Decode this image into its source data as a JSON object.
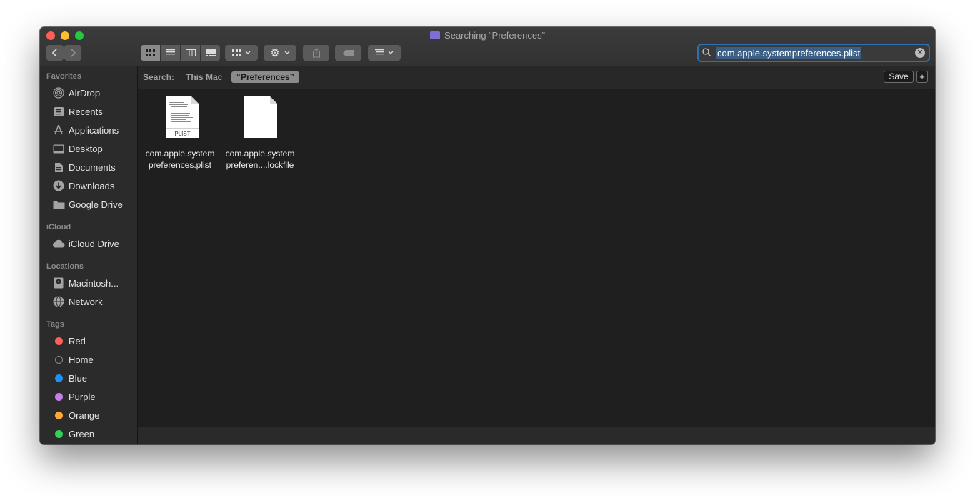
{
  "window": {
    "title": "Searching “Preferences”"
  },
  "search": {
    "query": "com.apple.systempreferences.plist"
  },
  "sidebar": {
    "favorites_header": "Favorites",
    "favorites": [
      {
        "label": "AirDrop"
      },
      {
        "label": "Recents"
      },
      {
        "label": "Applications"
      },
      {
        "label": "Desktop"
      },
      {
        "label": "Documents"
      },
      {
        "label": "Downloads"
      },
      {
        "label": "Google Drive"
      }
    ],
    "icloud_header": "iCloud",
    "icloud": [
      {
        "label": "iCloud Drive"
      }
    ],
    "locations_header": "Locations",
    "locations": [
      {
        "label": "Macintosh..."
      },
      {
        "label": "Network"
      }
    ],
    "tags_header": "Tags",
    "tags": [
      {
        "label": "Red",
        "color": "#fe5f57"
      },
      {
        "label": "Home",
        "color": "none"
      },
      {
        "label": "Blue",
        "color": "#1f8ffe"
      },
      {
        "label": "Purple",
        "color": "#c77ee6"
      },
      {
        "label": "Orange",
        "color": "#fda83a"
      },
      {
        "label": "Green",
        "color": "#31d158"
      }
    ]
  },
  "scope": {
    "label": "Search:",
    "this_mac": "This Mac",
    "selected": "“Preferences”",
    "save": "Save",
    "add": "+"
  },
  "files": [
    {
      "line1": "com.apple.system",
      "line2": "preferences.plist",
      "badge": "PLIST"
    },
    {
      "line1": "com.apple.system",
      "line2": "preferen....lockfile"
    }
  ]
}
